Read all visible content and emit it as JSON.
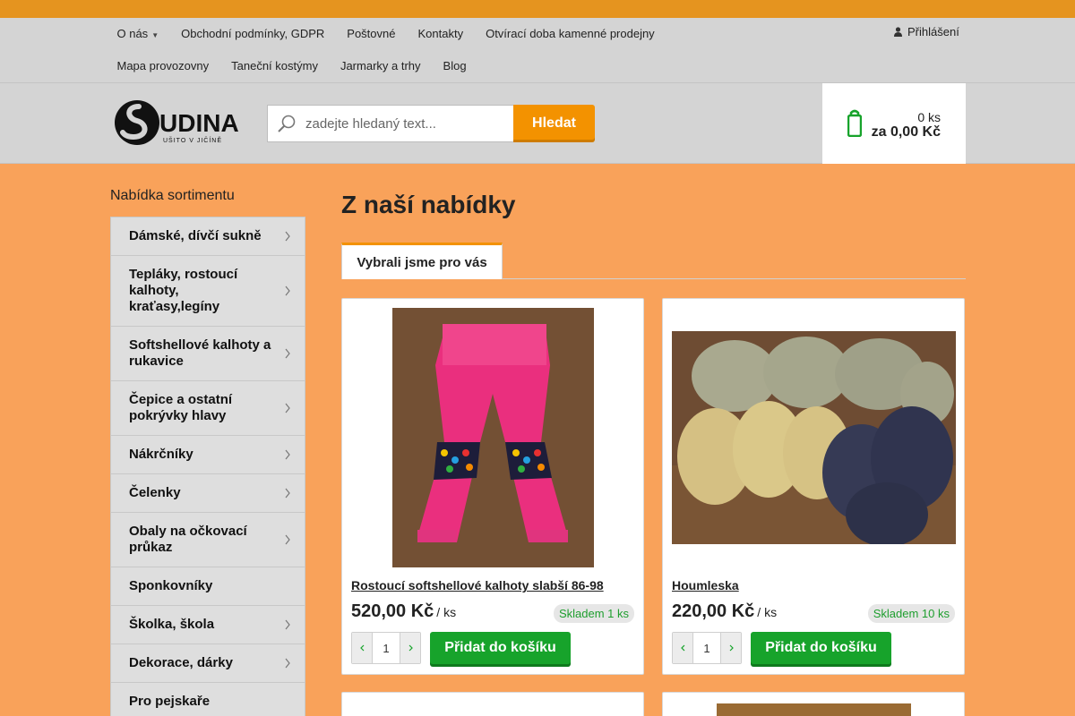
{
  "top_bar": {
    "close_glyph": ""
  },
  "nav": {
    "row1": [
      "O nás",
      "Obchodní podmínky, GDPR",
      "Poštovné",
      "Kontakty",
      "Otvírací doba kamenné prodejny"
    ],
    "row2": [
      "Mapa provozovny",
      "Taneční kostýmy",
      "Jarmarky a trhy",
      "Blog"
    ],
    "login_label": "Přihlášení"
  },
  "logo": {
    "text": "UDINA",
    "tagline": "UŠITO V JIČÍNĚ"
  },
  "search": {
    "placeholder": "zadejte hledaný text...",
    "button_label": "Hledat"
  },
  "cart": {
    "quantity": "0 ks",
    "total": "za 0,00 Kč"
  },
  "sidebar": {
    "title": "Nabídka sortimentu",
    "items": [
      {
        "label": "Dámské, dívčí sukně",
        "has_submenu": true
      },
      {
        "label": "Tepláky, rostoucí kalhoty, kraťasy,legíny",
        "has_submenu": true
      },
      {
        "label": "Softshellové kalhoty a rukavice",
        "has_submenu": true
      },
      {
        "label": "Čepice a ostatní pokrývky hlavy",
        "has_submenu": true
      },
      {
        "label": "Nákrčníky",
        "has_submenu": true
      },
      {
        "label": "Čelenky",
        "has_submenu": true
      },
      {
        "label": "Obaly na očkovací průkaz",
        "has_submenu": true
      },
      {
        "label": "Sponkovníky",
        "has_submenu": false
      },
      {
        "label": "Školka, škola",
        "has_submenu": true
      },
      {
        "label": "Dekorace, dárky",
        "has_submenu": true
      },
      {
        "label": "Pro pejskaře",
        "has_submenu": false
      }
    ]
  },
  "main": {
    "title": "Z naší nabídky",
    "tab_label": "Vybrali jsme pro vás",
    "products": [
      {
        "name": "Rostoucí softshellové kalhoty slabší 86-98",
        "price": "520,00 Kč",
        "unit": "/ ks",
        "stock": "Skladem 1 ks",
        "quantity": "1",
        "add_label": "Přidat do košíku"
      },
      {
        "name": "Houmleska",
        "price": "220,00 Kč",
        "unit": "/ ks",
        "stock": "Skladem 10 ks",
        "quantity": "1",
        "add_label": "Přidat do košíku"
      }
    ]
  },
  "colors": {
    "accent": "#f39200",
    "background": "#f9a25a",
    "nav": "#d4d4d4",
    "add_button": "#17a32b",
    "stock_text": "#1e9e2e"
  }
}
